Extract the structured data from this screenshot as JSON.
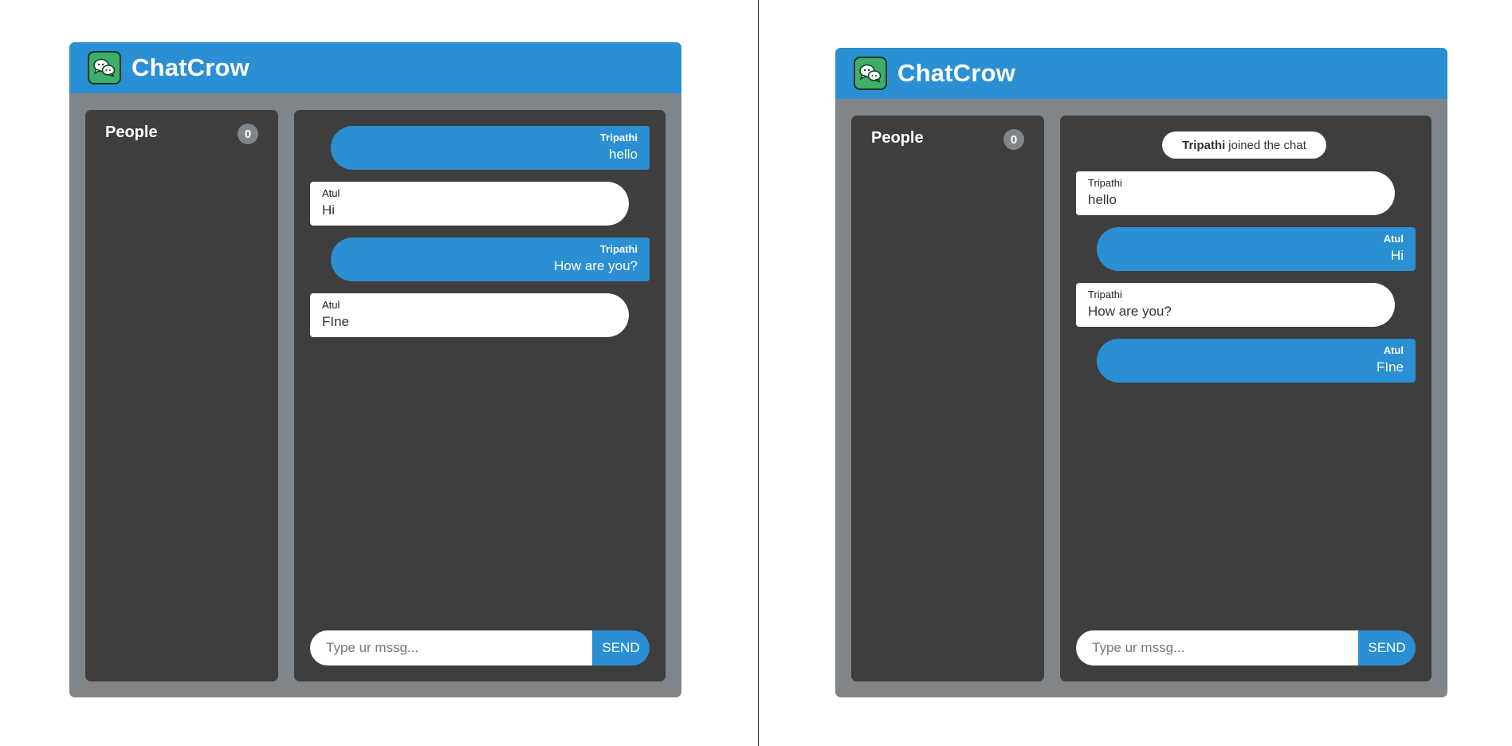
{
  "colors": {
    "header": "#2a8fd3",
    "frame": "#808589",
    "panel": "#3e3e3e",
    "own_bubble": "#2a8fd3",
    "other_bubble": "#ffffff",
    "logo": "#3eae6a"
  },
  "left_view": {
    "brand": "ChatCrow",
    "logo_icon": "chat-bubbles-icon",
    "people": {
      "title": "People",
      "count": "0"
    },
    "messages": [
      {
        "author": "Tripathi",
        "text": "hello",
        "side": "mine"
      },
      {
        "author": "Atul",
        "text": "Hi",
        "side": "theirs"
      },
      {
        "author": "Tripathi",
        "text": "How are you?",
        "side": "mine"
      },
      {
        "author": "Atul",
        "text": "FIne",
        "side": "theirs"
      }
    ],
    "composer": {
      "placeholder": "Type ur mssg...",
      "send_label": "SEND"
    }
  },
  "right_view": {
    "brand": "ChatCrow",
    "logo_icon": "chat-bubbles-icon",
    "people": {
      "title": "People",
      "count": "0"
    },
    "system_note": {
      "name": "Tripathi",
      "text": "joined the chat"
    },
    "messages": [
      {
        "author": "Tripathi",
        "text": "hello",
        "side": "theirs"
      },
      {
        "author": "Atul",
        "text": "Hi",
        "side": "mine"
      },
      {
        "author": "Tripathi",
        "text": "How are you?",
        "side": "theirs"
      },
      {
        "author": "Atul",
        "text": "FIne",
        "side": "mine"
      }
    ],
    "composer": {
      "placeholder": "Type ur mssg...",
      "send_label": "SEND"
    }
  }
}
